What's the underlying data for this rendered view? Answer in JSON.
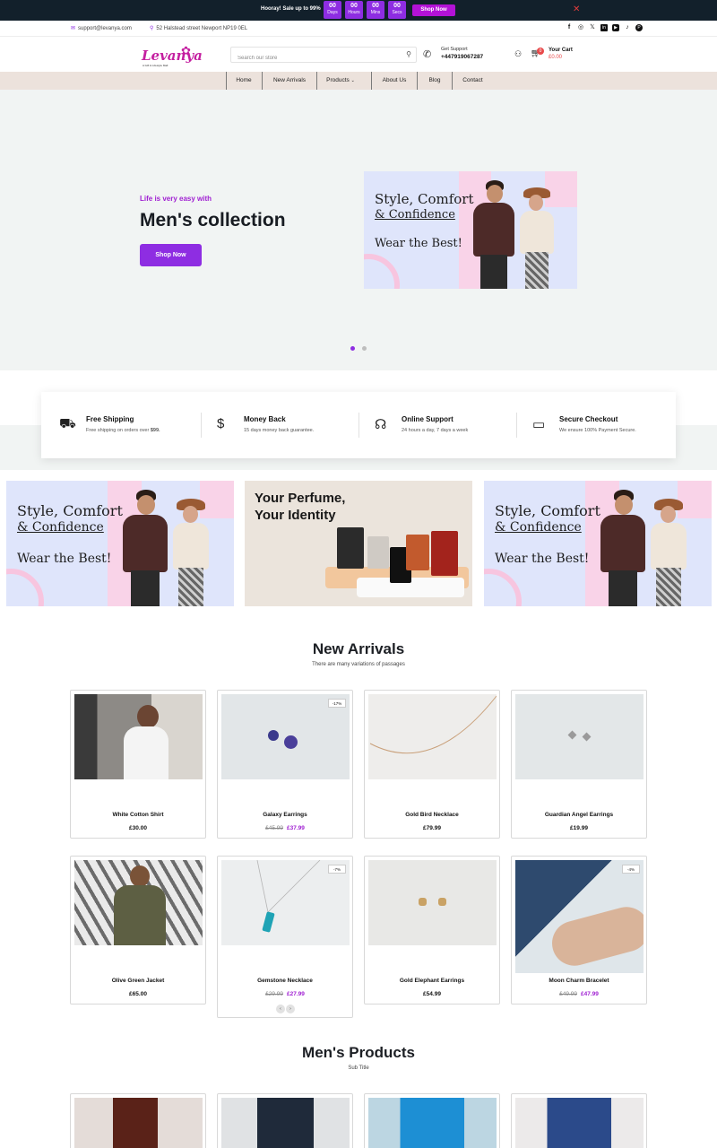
{
  "promo": {
    "text": "Hooray! Sale up to 99%",
    "countdown": [
      {
        "value": "00",
        "unit": "Days"
      },
      {
        "value": "00",
        "unit": "Hours"
      },
      {
        "value": "00",
        "unit": "Mins"
      },
      {
        "value": "00",
        "unit": "Secs"
      }
    ],
    "button": "Shop Now",
    "close": "✕"
  },
  "contact": {
    "email": "support@levanya.com",
    "address": "52 Halstead street Newport NP19 0EL",
    "social_icons": [
      "facebook-icon",
      "instagram-icon",
      "x-icon",
      "linkedin-icon",
      "youtube-icon",
      "tiktok-icon",
      "pinterest-icon"
    ]
  },
  "header": {
    "logo": "Levanya",
    "logo_tagline": "A Gift & Lifestyle Mall",
    "search_placeholder": "Search our store",
    "support_label": "Get Support",
    "support_phone": "+447919067287",
    "cart_label": "Your Cart",
    "cart_total": "£0.00",
    "cart_count": "0"
  },
  "nav": [
    "Home",
    "New Arrivals",
    "Products",
    "About Us",
    "Blog",
    "Contact"
  ],
  "hero": {
    "eyebrow": "Life is very easy with",
    "title": "Men's collection",
    "button": "Shop Now",
    "banner_line1": "Style, Comfort",
    "banner_line2": "& Confidence",
    "banner_line3": "Wear the Best!",
    "active_slide": 1,
    "slide_count": 2
  },
  "features": [
    {
      "icon": "truck-icon",
      "title": "Free Shipping",
      "desc": "Free shipping on orders over ",
      "desc_bold": "$99."
    },
    {
      "icon": "money-bag-icon",
      "title": "Money Back",
      "desc": "15 days money back guarantee.",
      "desc_bold": ""
    },
    {
      "icon": "headset-icon",
      "title": "Online Support",
      "desc": "24 hours a day, 7 days a week",
      "desc_bold": ""
    },
    {
      "icon": "card-icon",
      "title": "Secure Checkout",
      "desc": "We ensure 100% Payment Secure.",
      "desc_bold": ""
    }
  ],
  "banners": {
    "fashion_line1": "Style, Comfort",
    "fashion_line2": "& Confidence",
    "fashion_line3": "Wear the Best!",
    "perfume_line1": "Your Perfume,",
    "perfume_line2": "Your Identity"
  },
  "new_arrivals": {
    "title": "New Arrivals",
    "subtitle": "There are many variations of passages",
    "products": [
      {
        "name": "White Cotton Shirt",
        "price": "£30.00",
        "old_price": "",
        "badge": ""
      },
      {
        "name": "Galaxy Earrings",
        "price": "£37.99",
        "old_price": "£45.99",
        "badge": "-17%"
      },
      {
        "name": "Gold Bird Necklace",
        "price": "£79.99",
        "old_price": "",
        "badge": ""
      },
      {
        "name": "Guardian Angel Earrings",
        "price": "£19.99",
        "old_price": "",
        "badge": ""
      },
      {
        "name": "Olive Green Jacket",
        "price": "£65.00",
        "old_price": "",
        "badge": ""
      },
      {
        "name": "Gemstone Necklace",
        "price": "£27.99",
        "old_price": "£29.99",
        "badge": "-7%"
      },
      {
        "name": "Gold Elephant Earrings",
        "price": "£54.99",
        "old_price": "",
        "badge": ""
      },
      {
        "name": "Moon Charm Bracelet",
        "price": "£47.99",
        "old_price": "£49.99",
        "badge": "-4%"
      }
    ]
  },
  "mens_products": {
    "title": "Men's Products",
    "subtitle": "Sub Title"
  },
  "colors": {
    "accent": "#8e2de2",
    "dark": "#12202b",
    "brand": "#c41fa0",
    "nav_bg": "#ece2dc",
    "hero_bg": "#f1f4f3"
  }
}
